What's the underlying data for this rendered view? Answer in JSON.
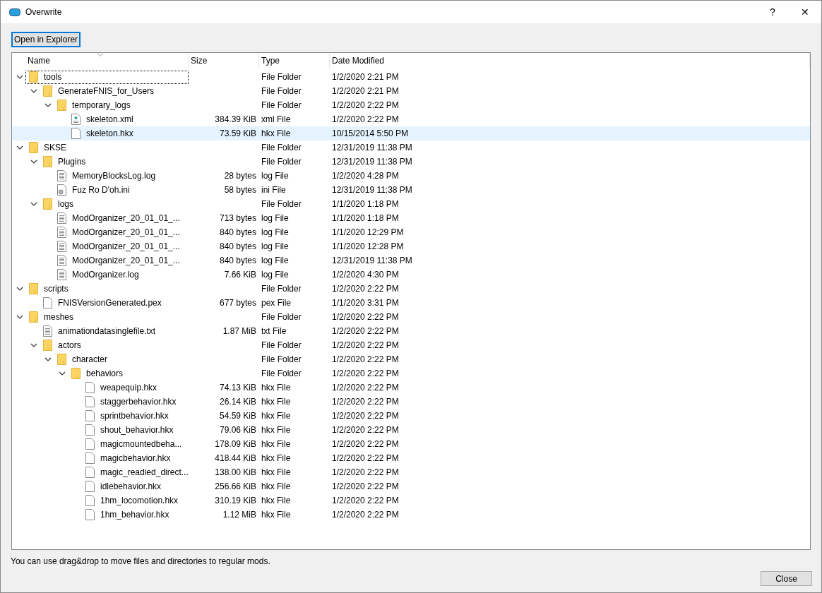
{
  "window": {
    "title": "Overwrite",
    "buttons": [
      "?",
      "✕"
    ]
  },
  "toolbar": {
    "button": "Open in Explorer"
  },
  "columns": [
    {
      "label": "Name",
      "sorted": true
    },
    {
      "label": "Size",
      "sorted": false
    },
    {
      "label": "Type",
      "sorted": false
    },
    {
      "label": "Date Modified",
      "sorted": false
    }
  ],
  "tree": [
    {
      "kind": "folder",
      "name": "tools",
      "type": "File Folder",
      "date": "1/2/2020 2:21 PM",
      "expanded": true,
      "selected": false,
      "focused": true,
      "children": [
        {
          "kind": "folder",
          "name": "GenerateFNIS_for_Users",
          "type": "File Folder",
          "date": "1/2/2020 2:21 PM",
          "expanded": true,
          "selected": false,
          "focused": false,
          "children": [
            {
              "kind": "folder",
              "name": "temporary_logs",
              "type": "File Folder",
              "date": "1/2/2020 2:22 PM",
              "expanded": true,
              "selected": false,
              "focused": false,
              "children": [
                {
                  "kind": "xml",
                  "name": "skeleton.xml",
                  "size": "384.39 KiB",
                  "type": "xml File",
                  "date": "1/2/2020 2:22 PM",
                  "selected": false,
                  "focused": false
                },
                {
                  "kind": "file",
                  "name": "skeleton.hkx",
                  "size": "73.59 KiB",
                  "type": "hkx File",
                  "date": "10/15/2014 5:50 PM",
                  "selected": true,
                  "focused": false
                }
              ]
            }
          ]
        }
      ]
    },
    {
      "kind": "folder",
      "name": "SKSE",
      "type": "File Folder",
      "date": "12/31/2019 11:38 PM",
      "expanded": true,
      "selected": false,
      "focused": false,
      "children": [
        {
          "kind": "folder",
          "name": "Plugins",
          "type": "File Folder",
          "date": "12/31/2019 11:38 PM",
          "expanded": true,
          "selected": false,
          "focused": false,
          "children": [
            {
              "kind": "text",
              "name": "MemoryBlocksLog.log",
              "size": "28 bytes",
              "type": "log File",
              "date": "1/2/2020 4:28 PM",
              "selected": false,
              "focused": false
            },
            {
              "kind": "ini",
              "name": "Fuz Ro D'oh.ini",
              "size": "58 bytes",
              "type": "ini File",
              "date": "12/31/2019 11:38 PM",
              "selected": false,
              "focused": false
            }
          ]
        },
        {
          "kind": "folder",
          "name": "logs",
          "type": "File Folder",
          "date": "1/1/2020 1:18 PM",
          "expanded": true,
          "selected": false,
          "focused": false,
          "children": [
            {
              "kind": "text",
              "name": "ModOrganizer_20_01_01_...",
              "size": "713 bytes",
              "type": "log File",
              "date": "1/1/2020 1:18 PM",
              "selected": false,
              "focused": false
            },
            {
              "kind": "text",
              "name": "ModOrganizer_20_01_01_...",
              "size": "840 bytes",
              "type": "log File",
              "date": "1/1/2020 12:29 PM",
              "selected": false,
              "focused": false
            },
            {
              "kind": "text",
              "name": "ModOrganizer_20_01_01_...",
              "size": "840 bytes",
              "type": "log File",
              "date": "1/1/2020 12:28 PM",
              "selected": false,
              "focused": false
            },
            {
              "kind": "text",
              "name": "ModOrganizer_20_01_01_...",
              "size": "840 bytes",
              "type": "log File",
              "date": "12/31/2019 11:38 PM",
              "selected": false,
              "focused": false
            },
            {
              "kind": "text",
              "name": "ModOrganizer.log",
              "size": "7.66 KiB",
              "type": "log File",
              "date": "1/2/2020 4:30 PM",
              "selected": false,
              "focused": false
            }
          ]
        }
      ]
    },
    {
      "kind": "folder",
      "name": "scripts",
      "type": "File Folder",
      "date": "1/2/2020 2:22 PM",
      "expanded": true,
      "selected": false,
      "focused": false,
      "children": [
        {
          "kind": "file",
          "name": "FNISVersionGenerated.pex",
          "size": "677 bytes",
          "type": "pex File",
          "date": "1/1/2020 3:31 PM",
          "selected": false,
          "focused": false
        }
      ]
    },
    {
      "kind": "folder",
      "name": "meshes",
      "type": "File Folder",
      "date": "1/2/2020 2:22 PM",
      "expanded": true,
      "selected": false,
      "focused": false,
      "children": [
        {
          "kind": "text",
          "name": "animationdatasinglefile.txt",
          "size": "1.87 MiB",
          "type": "txt File",
          "date": "1/2/2020 2:22 PM",
          "selected": false,
          "focused": false
        },
        {
          "kind": "folder",
          "name": "actors",
          "type": "File Folder",
          "date": "1/2/2020 2:22 PM",
          "expanded": true,
          "selected": false,
          "focused": false,
          "children": [
            {
              "kind": "folder",
              "name": "character",
              "type": "File Folder",
              "date": "1/2/2020 2:22 PM",
              "expanded": true,
              "selected": false,
              "focused": false,
              "children": [
                {
                  "kind": "folder",
                  "name": "behaviors",
                  "type": "File Folder",
                  "date": "1/2/2020 2:22 PM",
                  "expanded": true,
                  "selected": false,
                  "focused": false,
                  "children": [
                    {
                      "kind": "file",
                      "name": "weapequip.hkx",
                      "size": "74.13 KiB",
                      "type": "hkx File",
                      "date": "1/2/2020 2:22 PM",
                      "selected": false,
                      "focused": false
                    },
                    {
                      "kind": "file",
                      "name": "staggerbehavior.hkx",
                      "size": "26.14 KiB",
                      "type": "hkx File",
                      "date": "1/2/2020 2:22 PM",
                      "selected": false,
                      "focused": false
                    },
                    {
                      "kind": "file",
                      "name": "sprintbehavior.hkx",
                      "size": "54.59 KiB",
                      "type": "hkx File",
                      "date": "1/2/2020 2:22 PM",
                      "selected": false,
                      "focused": false
                    },
                    {
                      "kind": "file",
                      "name": "shout_behavior.hkx",
                      "size": "79.06 KiB",
                      "type": "hkx File",
                      "date": "1/2/2020 2:22 PM",
                      "selected": false,
                      "focused": false
                    },
                    {
                      "kind": "file",
                      "name": "magicmountedbeha...",
                      "size": "178.09 KiB",
                      "type": "hkx File",
                      "date": "1/2/2020 2:22 PM",
                      "selected": false,
                      "focused": false
                    },
                    {
                      "kind": "file",
                      "name": "magicbehavior.hkx",
                      "size": "418.44 KiB",
                      "type": "hkx File",
                      "date": "1/2/2020 2:22 PM",
                      "selected": false,
                      "focused": false
                    },
                    {
                      "kind": "file",
                      "name": "magic_readied_direct...",
                      "size": "138.00 KiB",
                      "type": "hkx File",
                      "date": "1/2/2020 2:22 PM",
                      "selected": false,
                      "focused": false
                    },
                    {
                      "kind": "file",
                      "name": "idlebehavior.hkx",
                      "size": "256.66 KiB",
                      "type": "hkx File",
                      "date": "1/2/2020 2:22 PM",
                      "selected": false,
                      "focused": false
                    },
                    {
                      "kind": "file",
                      "name": "1hm_locomotion.hkx",
                      "size": "310.19 KiB",
                      "type": "hkx File",
                      "date": "1/2/2020 2:22 PM",
                      "selected": false,
                      "focused": false
                    },
                    {
                      "kind": "file",
                      "name": "1hm_behavior.hkx",
                      "size": "1.12 MiB",
                      "type": "hkx File",
                      "date": "1/2/2020 2:22 PM",
                      "selected": false,
                      "focused": false
                    }
                  ]
                }
              ]
            }
          ]
        }
      ]
    }
  ],
  "status": "You can use drag&drop to move files and directories to regular mods.",
  "footer": {
    "button": "Close"
  }
}
